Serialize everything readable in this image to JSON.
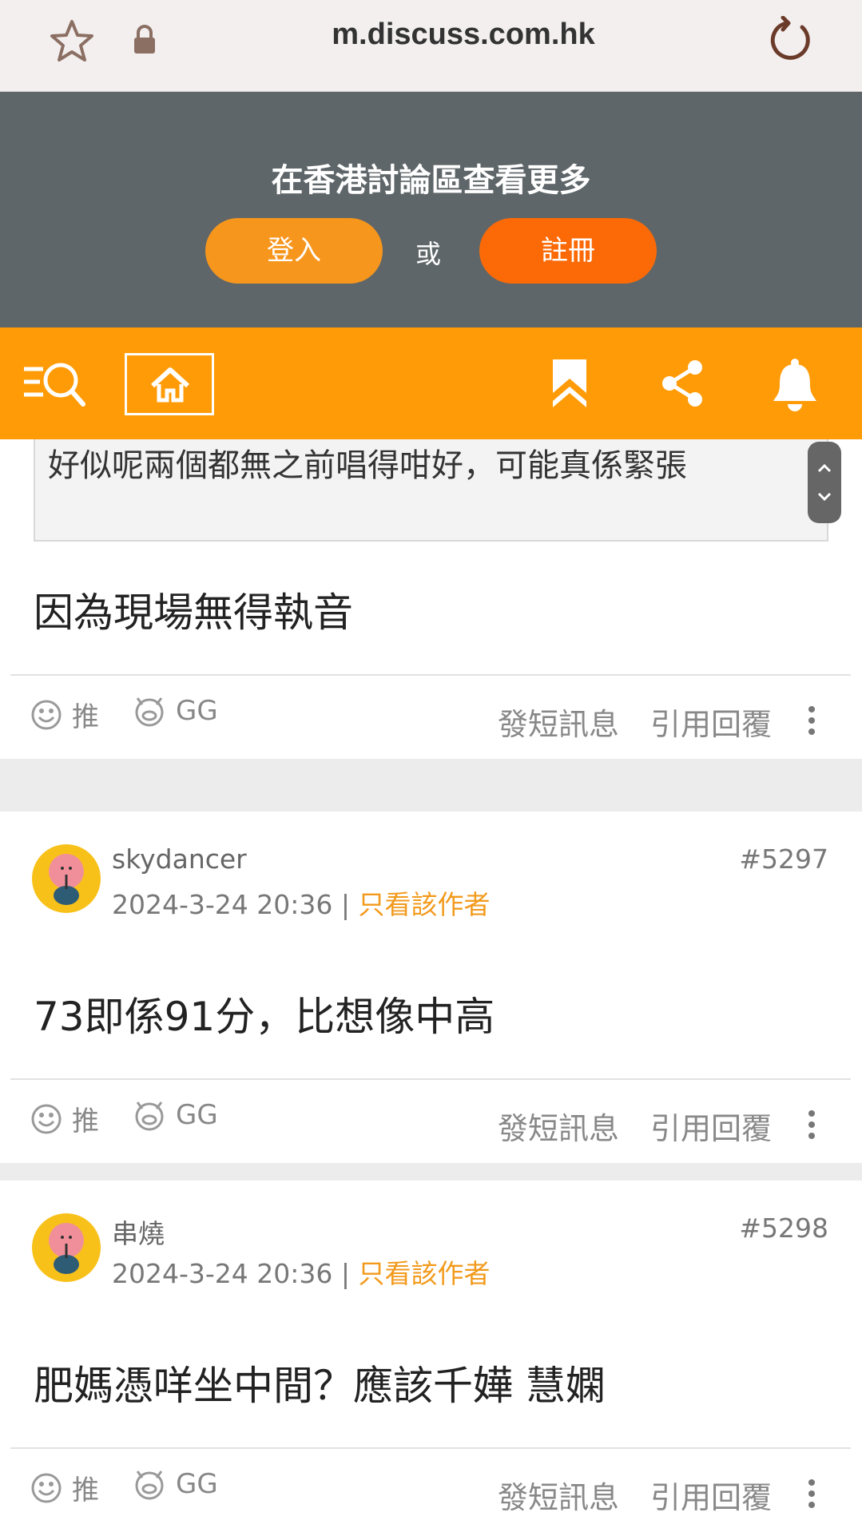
{
  "browser": {
    "url": "m.discuss.com.hk"
  },
  "login_prompt": {
    "title": "在香港討論區查看更多",
    "login_label": "登入",
    "or_label": "或",
    "register_label": "註冊"
  },
  "colors": {
    "toolbar": "#ff9b06",
    "login_button": "#f7961d",
    "register_button": "#fb6a07",
    "prompt_bg": "#5f6669",
    "author_link": "#f29a1c"
  },
  "quote": {
    "text": "好似呢兩個都無之前唱得咁好，可能真係緊張"
  },
  "first_post": {
    "body": "因為現場無得執音"
  },
  "actions": {
    "like": "推",
    "gg": "GG",
    "pm": "發短訊息",
    "quote_reply": "引用回覆"
  },
  "posts": [
    {
      "author": "skydancer",
      "date": "2024-3-24 20:36",
      "separator": "|",
      "only_author": "只看該作者",
      "number": "#5297",
      "body": "73即係91分，比想像中高"
    },
    {
      "author": "串燒",
      "date": "2024-3-24 20:36",
      "separator": "|",
      "only_author": "只看該作者",
      "number": "#5298",
      "body": "肥媽憑咩坐中間？應該千嬅 慧嫻"
    }
  ]
}
